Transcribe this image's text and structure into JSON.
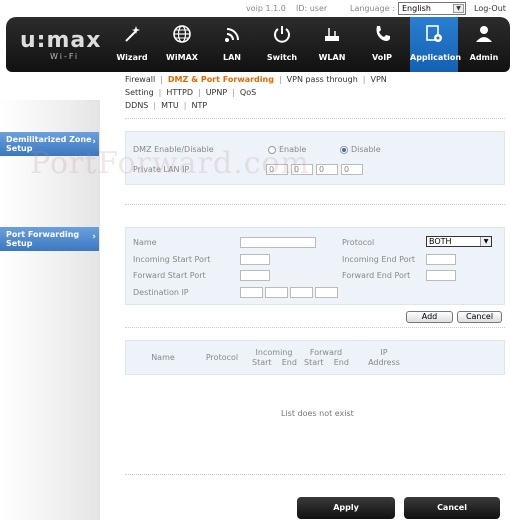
{
  "topbar": {
    "version": "voip 1.1.0",
    "user_id": "ID: user",
    "language_label": "Language :",
    "language_value": "English",
    "logout": "Log-Out"
  },
  "brand": {
    "logo": "u:max",
    "sub": "Wi-Fi"
  },
  "nav": [
    {
      "label": "Wizard",
      "icon": "wand-icon"
    },
    {
      "label": "WiMAX",
      "icon": "globe-icon"
    },
    {
      "label": "LAN",
      "icon": "signal-icon"
    },
    {
      "label": "Switch",
      "icon": "power-icon"
    },
    {
      "label": "WLAN",
      "icon": "router-icon"
    },
    {
      "label": "VoIP",
      "icon": "phone-icon"
    },
    {
      "label": "Application",
      "icon": "application-icon",
      "active": true
    },
    {
      "label": "Admin",
      "icon": "user-icon"
    }
  ],
  "subnav": {
    "row1": [
      "Firewall",
      "DMZ & Port Forwarding",
      "VPN pass through",
      "VPN Setting",
      "HTTPD",
      "UPNP",
      "QoS"
    ],
    "row2": [
      "DDNS",
      "MTU",
      "NTP"
    ],
    "current": "DMZ & Port Forwarding"
  },
  "sidebar": {
    "dmz_tab": "Demilitarized Zone Setup",
    "pf_tab": "Port Forwarding Setup"
  },
  "dmz": {
    "enable_label": "DMZ Enable/Disable",
    "enable_option": "Enable",
    "disable_option": "Disable",
    "selected": "Disable",
    "ip_label": "Private LAN IP",
    "ip": [
      "0",
      "0",
      "0",
      "0"
    ]
  },
  "pf": {
    "name_label": "Name",
    "protocol_label": "Protocol",
    "protocol_value": "BOTH",
    "incoming_start_label": "Incoming Start Port",
    "incoming_end_label": "Incoming End Port",
    "forward_start_label": "Forward Start Port",
    "forward_end_label": "Forward End Port",
    "dest_ip_label": "Destination IP",
    "add_button": "Add",
    "cancel_button": "Cancel"
  },
  "table": {
    "col_name": "Name",
    "col_protocol": "Protocol",
    "col_incoming": "Incoming",
    "col_incoming_sub": "Start    End",
    "col_forward": "Forward",
    "col_forward_sub": "Start    End",
    "col_ip": "IP",
    "col_ip_sub": "Address",
    "empty_text": "List does not exist"
  },
  "footer": {
    "apply": "Apply",
    "cancel": "Cancel"
  },
  "watermark": "PortForward.com",
  "colors": {
    "accent": "#1f6fc0",
    "current_tab": "#e06a00",
    "header": "#1a1a1a",
    "panel": "#eef3fa"
  }
}
